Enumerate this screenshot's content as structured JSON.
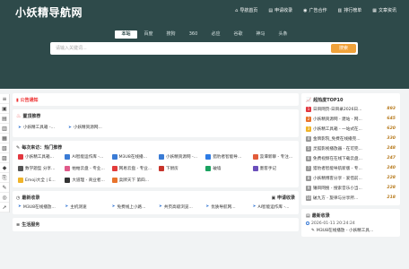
{
  "site": {
    "logo": "小妖精导航网"
  },
  "topnav": [
    {
      "icon": "home-icon",
      "glyph": "⌂",
      "label": "导航首页"
    },
    {
      "icon": "submit-icon",
      "glyph": "▤",
      "label": "申请收录"
    },
    {
      "icon": "megaphone-icon",
      "glyph": "◉",
      "label": "广告合作"
    },
    {
      "icon": "chart-icon",
      "glyph": "▥",
      "label": "排行榜单"
    },
    {
      "icon": "article-icon",
      "glyph": "▦",
      "label": "文章资讯"
    }
  ],
  "search": {
    "tabs": [
      "本站",
      "百度",
      "搜狗",
      "360",
      "必应",
      "谷歌",
      "神马",
      "头条"
    ],
    "placeholder": "请输入关键词...",
    "button": "搜索"
  },
  "rail_icons": [
    "≡",
    "▣",
    "▤",
    "▥",
    "▦",
    "▧",
    "▨",
    "◆",
    "⎘",
    "✎",
    "◎",
    "➚"
  ],
  "notice": {
    "label": "公告通知",
    "icon": "speaker-icon"
  },
  "hot": {
    "title": "置顶推荐",
    "items": [
      "小妖精工具箱 -...",
      "小妖精资源网..."
    ]
  },
  "popular": {
    "title": "每次来访：热门推荐",
    "items": [
      {
        "label": "小妖精工具箱...",
        "color": "#e2373f"
      },
      {
        "label": "AI智能运作库 -...",
        "color": "#3a7bd5"
      },
      {
        "label": "M3U8在线播...",
        "color": "#3a7bd5"
      },
      {
        "label": "小妖精资源网 -...",
        "color": "#3a7bd5"
      },
      {
        "label": "猎豹者智能导...",
        "color": "#2d7be5"
      },
      {
        "label": "汲谭新聊 - 专注...",
        "color": "#e25c3b"
      },
      {
        "label": "数学题型 分享...",
        "color": "#555555"
      },
      {
        "label": "帕帕云盘 - 专业...",
        "color": "#e05a8a"
      },
      {
        "label": "网易云盘 - 专业...",
        "color": "#e23b3b"
      },
      {
        "label": "下厨房",
        "color": "#c7342b"
      },
      {
        "label": "破墙",
        "color": "#1aa260"
      },
      {
        "label": "墨客手记",
        "color": "#6b4fbb"
      },
      {
        "label": "Emoji大全 | E...",
        "color": "#f0b429"
      },
      {
        "label": "大道理 - 商业者...",
        "color": "#333333"
      },
      {
        "label": "卖牌天下 第四...",
        "color": "#e8732c"
      }
    ]
  },
  "newest": {
    "title": "最新收录",
    "button": "申请收录",
    "items": [
      "M3U8在线播放...",
      "主机测速",
      "免费线上小路...",
      "共页高级浏览...",
      "优质导航网...",
      "AI智能运作库 -..."
    ]
  },
  "life": {
    "title": "生活服务"
  },
  "ranking": {
    "title": "超热度TOP10",
    "items": [
      {
        "rank": "1",
        "label": "日目网页-日目录2026日...",
        "value": "893",
        "color": "#e2373f"
      },
      {
        "rank": "2",
        "label": "小妖精资源网 - 建站 - 网...",
        "value": "645",
        "color": "#e8732c"
      },
      {
        "rank": "3",
        "label": "小妖精工具箱 - 一站式在...",
        "value": "620",
        "color": "#f0b429"
      },
      {
        "rank": "4",
        "label": "金牌影院_免费在线播完...",
        "value": "330",
        "color": "#999999"
      },
      {
        "rank": "5",
        "label": "灵狐影视播放器 - 在可完...",
        "value": "248",
        "color": "#999999"
      },
      {
        "rank": "6",
        "label": "免费视频在在线下载云盘...",
        "value": "247",
        "color": "#999999"
      },
      {
        "rank": "7",
        "label": "猎豹者智能导航新版 - 专...",
        "value": "240",
        "color": "#999999"
      },
      {
        "rank": "8",
        "label": "小妖精博客分享 - 爱惜前...",
        "value": "228",
        "color": "#999999"
      },
      {
        "rank": "9",
        "label": "锤目网搜 - 搜索音乐小当...",
        "value": "228",
        "color": "#999999"
      },
      {
        "rank": "10",
        "label": "破九方 - 旋律与分享所...",
        "value": "218",
        "color": "#999999"
      }
    ]
  },
  "recent": {
    "title": "最新收录",
    "time": "2026-01-11 20:24:24",
    "items": [
      "M3U8在线播放 - 小妖精工具..."
    ]
  }
}
